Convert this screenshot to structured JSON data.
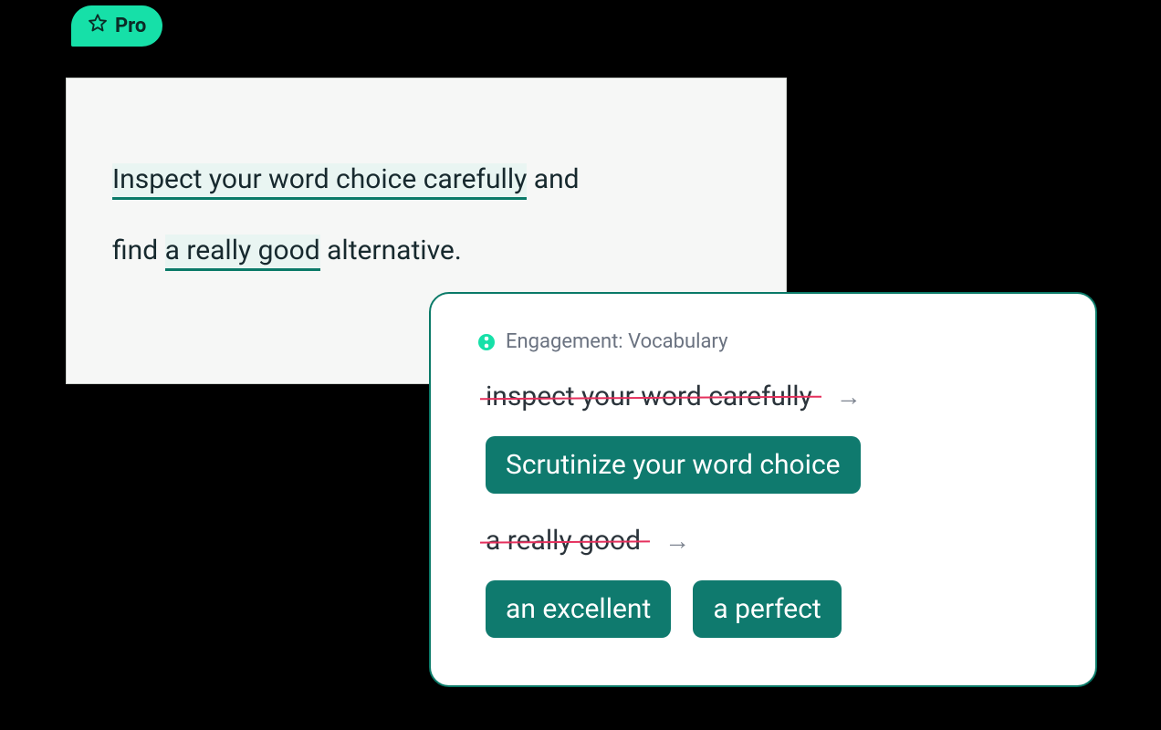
{
  "badge": {
    "label": "Pro"
  },
  "editor": {
    "line1": {
      "hl": "Inspect your word choice carefully",
      "tail": " and"
    },
    "line2": {
      "lead": "find ",
      "hl": "a really good",
      "tail": " alternative."
    }
  },
  "popover": {
    "category": "Engagement: Vocabulary",
    "suggestions": [
      {
        "strike": "inspect your word carefully",
        "chips": [
          "Scrutinize your word choice"
        ]
      },
      {
        "strike": "a really good",
        "chips": [
          "an excellent",
          "a perfect"
        ]
      }
    ]
  }
}
